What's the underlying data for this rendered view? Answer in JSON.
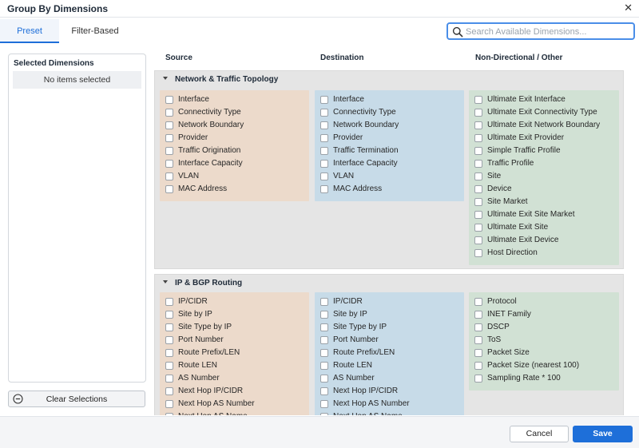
{
  "dialog": {
    "title": "Group By Dimensions",
    "close_glyph": "✕"
  },
  "tabs": [
    {
      "label": "Preset",
      "active": true
    },
    {
      "label": "Filter-Based",
      "active": false
    }
  ],
  "search": {
    "placeholder": "Search Available Dimensions...",
    "value": "",
    "icon": "search-icon"
  },
  "selected_panel": {
    "title": "Selected Dimensions",
    "empty_text": "No items selected"
  },
  "clear_button": {
    "label": "Clear Selections",
    "icon": "minus-circle-icon"
  },
  "columns": {
    "source": "Source",
    "destination": "Destination",
    "other": "Non-Directional / Other"
  },
  "sections": [
    {
      "title": "Network & Traffic Topology",
      "source": [
        "Interface",
        "Connectivity Type",
        "Network Boundary",
        "Provider",
        "Traffic Origination",
        "Interface Capacity",
        "VLAN",
        "MAC Address"
      ],
      "destination": [
        "Interface",
        "Connectivity Type",
        "Network Boundary",
        "Provider",
        "Traffic Termination",
        "Interface Capacity",
        "VLAN",
        "MAC Address"
      ],
      "other": [
        "Ultimate Exit Interface",
        "Ultimate Exit Connectivity Type",
        "Ultimate Exit Network Boundary",
        "Ultimate Exit Provider",
        "Simple Traffic Profile",
        "Traffic Profile",
        "Site",
        "Device",
        "Site Market",
        "Ultimate Exit Site Market",
        "Ultimate Exit Site",
        "Ultimate Exit Device",
        "Host Direction"
      ]
    },
    {
      "title": "IP & BGP Routing",
      "source": [
        "IP/CIDR",
        "Site by IP",
        "Site Type by IP",
        "Port Number",
        "Route Prefix/LEN",
        "Route LEN",
        "AS Number",
        "Next Hop IP/CIDR",
        "Next Hop AS Number",
        "Next Hop AS Name"
      ],
      "destination": [
        "IP/CIDR",
        "Site by IP",
        "Site Type by IP",
        "Port Number",
        "Route Prefix/LEN",
        "Route LEN",
        "AS Number",
        "Next Hop IP/CIDR",
        "Next Hop AS Number",
        "Next Hop AS Name"
      ],
      "other": [
        "Protocol",
        "INET Family",
        "DSCP",
        "ToS",
        "Packet Size",
        "Packet Size (nearest 100)",
        "Sampling Rate * 100"
      ]
    }
  ],
  "footer": {
    "cancel_label": "Cancel",
    "save_label": "Save"
  },
  "colors": {
    "accent": "#1e6fd9",
    "source_bg": "#ecdacb",
    "destination_bg": "#c7dbe8",
    "other_bg": "#d1e1d4",
    "section_bg": "#e5e5e5"
  }
}
